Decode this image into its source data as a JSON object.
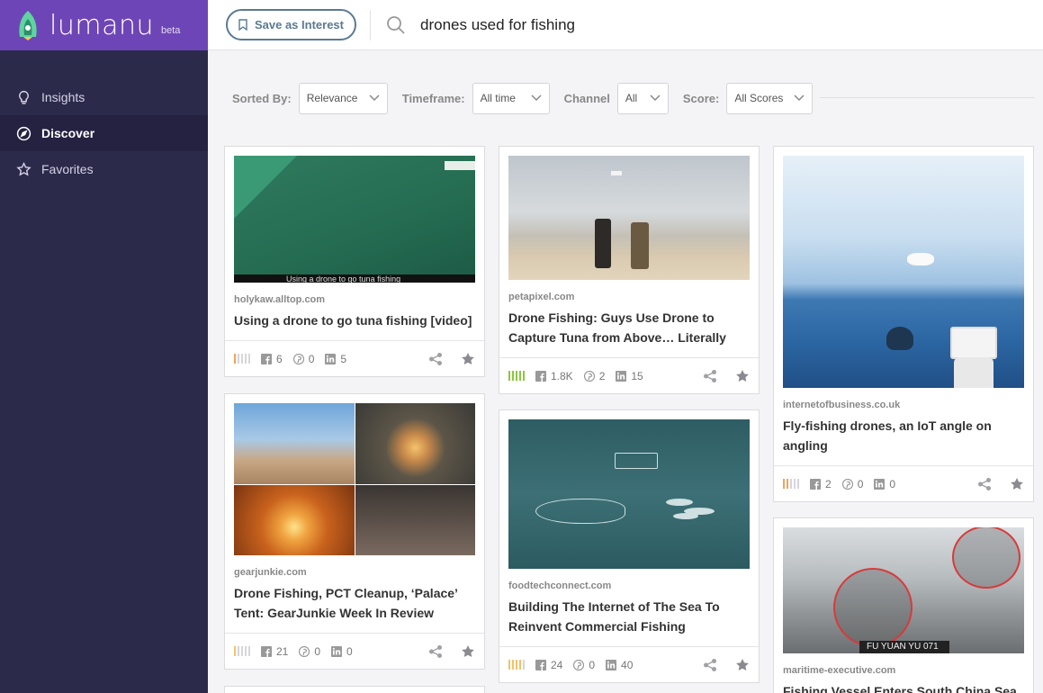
{
  "brand": {
    "name": "lumanu",
    "beta": "beta"
  },
  "nav": [
    {
      "label": "Insights",
      "icon": "lightbulb-icon",
      "active": false
    },
    {
      "label": "Discover",
      "icon": "compass-icon",
      "active": true
    },
    {
      "label": "Favorites",
      "icon": "star-icon",
      "active": false
    }
  ],
  "topbar": {
    "save_label": "Save as Interest",
    "search_value": "drones used for fishing"
  },
  "filters": {
    "sorted_by": {
      "label": "Sorted By:",
      "value": "Relevance"
    },
    "timeframe": {
      "label": "Timeframe:",
      "value": "All time"
    },
    "channel": {
      "label": "Channel",
      "value": "All"
    },
    "score": {
      "label": "Score:",
      "value": "All Scores"
    }
  },
  "colors": {
    "sidebar": "#2c2a4a",
    "brand": "#6e45b6",
    "score_orange": "#f0a35e",
    "score_green": "#8cc63f",
    "score_yellow": "#f3c26b"
  },
  "cards": [
    {
      "domain": "holykaw.alltop.com",
      "title": "Using a drone to go tuna fishing [video]",
      "fb": "6",
      "pin": "0",
      "li": "5",
      "score": 1,
      "caption": "Using a drone to go tuna fishing"
    },
    {
      "domain": "gearjunkie.com",
      "title": "Drone Fishing, PCT Cleanup, ‘Palace’ Tent: GearJunkie Week In Review",
      "fb": "21",
      "pin": "0",
      "li": "0",
      "score": 1
    },
    {
      "domain": "petapixel.com",
      "title": "Drone Fishing: Guys Use Drone to Capture Tuna from Above… Literally",
      "fb": "1.8K",
      "pin": "2",
      "li": "15",
      "score": 5
    },
    {
      "domain": "foodtechconnect.com",
      "title": "Building The Internet of The Sea To Reinvent Commercial Fishing",
      "fb": "24",
      "pin": "0",
      "li": "40",
      "score": 4
    },
    {
      "domain": "internetofbusiness.co.uk",
      "title": "Fly-fishing drones, an IoT angle on angling",
      "fb": "2",
      "pin": "0",
      "li": "0",
      "score": 2
    },
    {
      "domain": "maritime-executive.com",
      "title": "Fishing Vessel Enters South China Sea",
      "image_text": "FU YUAN YU 071"
    }
  ]
}
